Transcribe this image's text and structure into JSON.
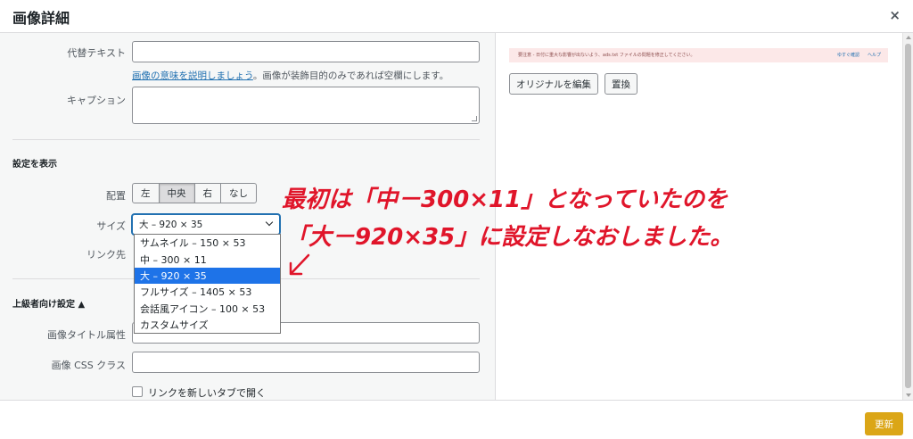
{
  "header": {
    "title": "画像詳細",
    "close_symbol": "×"
  },
  "left": {
    "alt_text": {
      "label": "代替テキスト",
      "value": ""
    },
    "alt_help": {
      "link": "画像の意味を説明しましょう",
      "rest": "。画像が装飾目的のみであれば空欄にします。"
    },
    "caption": {
      "label": "キャプション",
      "value": ""
    },
    "display_settings": {
      "title": "設定を表示",
      "alignment_label": "配置",
      "alignment_options": [
        "左",
        "中央",
        "右",
        "なし"
      ],
      "alignment_selected": "中央",
      "size_label": "サイズ",
      "size_selected": "大 – 920 × 35",
      "size_options": [
        "サムネイル – 150 × 53",
        "中 – 300 × 11",
        "大 – 920 × 35",
        "フルサイズ – 1405 × 53",
        "会話風アイコン – 100 × 53",
        "カスタムサイズ"
      ],
      "link_label": "リンク先"
    },
    "advanced": {
      "title": "上級者向け設定 ▲",
      "image_title_label": "画像タイトル属性",
      "image_title_value": "",
      "css_class_label": "画像 CSS クラス",
      "css_class_value": "",
      "new_tab_label": "リンクを新しいタブで開く"
    }
  },
  "right": {
    "notice_text": "要注意 - 日付に重大な影響が出ないよう、ads.txt ファイルの問題を修正してください。",
    "notice_link1": "ゆすぐ確認",
    "notice_link2": "ヘルプ",
    "edit_original": "オリジナルを編集",
    "replace": "置換"
  },
  "annotation": {
    "line1": "最初は「中－300×11」となっていたのを",
    "line2": "「大－920×35」に設定しなおしました。"
  },
  "footer": {
    "update": "更新"
  },
  "colors": {
    "accent": "#2271b1",
    "highlight": "#1e73e8",
    "annotation": "#e0152a",
    "update_button": "#dba617"
  }
}
